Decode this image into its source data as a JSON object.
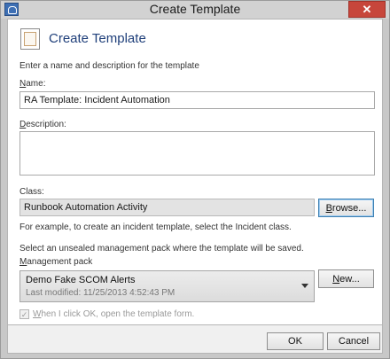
{
  "window": {
    "title": "Create Template",
    "close_label": "✕"
  },
  "header": {
    "title": "Create Template"
  },
  "intro": "Enter a name and description for the template",
  "name": {
    "label_key": "N",
    "label_rest": "ame:",
    "value": "RA Template: Incident Automation"
  },
  "description": {
    "label_key": "D",
    "label_rest": "escription:",
    "value": ""
  },
  "class": {
    "label": "Class:",
    "value": "Runbook Automation Activity",
    "browse_key": "B",
    "browse_rest": "rowse...",
    "hint": "For example, to create an incident template, select the Incident class."
  },
  "management_pack": {
    "instruction": "Select an unsealed management pack where the template will be saved.",
    "label_key": "M",
    "label_rest": "anagement pack",
    "selected_name": "Demo Fake SCOM Alerts",
    "selected_modified": "Last modified:  11/25/2013 4:52:43 PM",
    "new_key": "N",
    "new_rest": "ew..."
  },
  "open_form": {
    "checked": true,
    "label_key": "W",
    "label_rest": "hen I click OK, open the template form."
  },
  "footer": {
    "ok_label": "OK",
    "cancel_label": "Cancel"
  }
}
